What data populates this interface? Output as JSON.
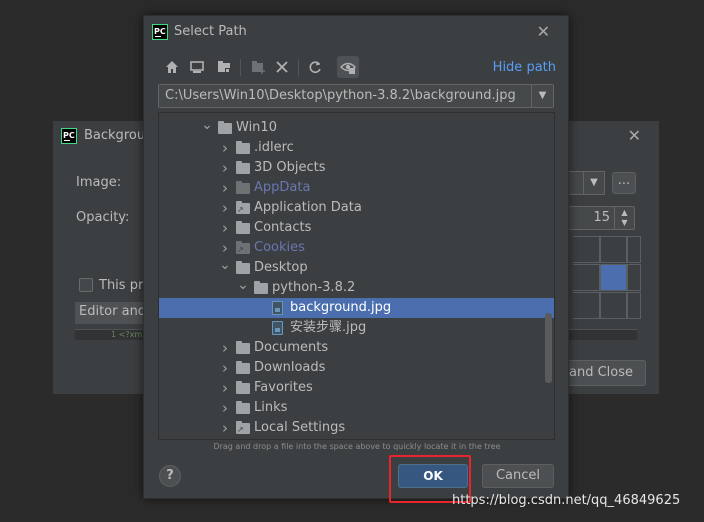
{
  "background_dialog": {
    "title": "Backgroun",
    "image_label": "Image:",
    "opacity_label": "Opacity:",
    "opacity_value": "15",
    "browse_label": "...",
    "checkbox_label": "This pro",
    "tab_label": "Editor and",
    "code_line": "1   <?xm",
    "save_button": "and Close"
  },
  "select_path_dialog": {
    "title": "Select Path",
    "hide_path_label": "Hide path",
    "path_value": "C:\\Users\\Win10\\Desktop\\python-3.8.2\\background.jpg",
    "toolbar": {
      "home_icon": "home-icon",
      "desktop_icon": "desktop-icon",
      "project_icon": "project-folder-icon",
      "new_folder_icon": "new-folder-icon",
      "delete_icon": "delete-icon",
      "refresh_icon": "refresh-icon",
      "show_hidden_icon": "show-hidden-icon"
    },
    "tree": [
      {
        "label": "Win10",
        "depth": 0,
        "expanded": true,
        "type": "folder"
      },
      {
        "label": ".idlerc",
        "depth": 1,
        "expanded": false,
        "type": "folder"
      },
      {
        "label": "3D Objects",
        "depth": 1,
        "expanded": false,
        "type": "folder"
      },
      {
        "label": "AppData",
        "depth": 1,
        "expanded": false,
        "type": "folder",
        "dim": true
      },
      {
        "label": "Application Data",
        "depth": 1,
        "expanded": false,
        "type": "folder",
        "shortcut": true
      },
      {
        "label": "Contacts",
        "depth": 1,
        "expanded": false,
        "type": "folder"
      },
      {
        "label": "Cookies",
        "depth": 1,
        "expanded": false,
        "type": "folder",
        "dim": true,
        "shortcut": true
      },
      {
        "label": "Desktop",
        "depth": 1,
        "expanded": true,
        "type": "folder"
      },
      {
        "label": "python-3.8.2",
        "depth": 2,
        "expanded": true,
        "type": "folder"
      },
      {
        "label": "background.jpg",
        "depth": 3,
        "type": "file",
        "selected": true
      },
      {
        "label": "安装步骤.jpg",
        "depth": 3,
        "type": "file"
      },
      {
        "label": "Documents",
        "depth": 1,
        "expanded": false,
        "type": "folder"
      },
      {
        "label": "Downloads",
        "depth": 1,
        "expanded": false,
        "type": "folder"
      },
      {
        "label": "Favorites",
        "depth": 1,
        "expanded": false,
        "type": "folder"
      },
      {
        "label": "Links",
        "depth": 1,
        "expanded": false,
        "type": "folder"
      },
      {
        "label": "Local Settings",
        "depth": 1,
        "expanded": false,
        "type": "folder",
        "shortcut": true
      },
      {
        "label": "",
        "depth": 1,
        "expanded": false,
        "type": "folder"
      }
    ],
    "drag_hint": "Drag and drop a file into the space above to quickly locate it in the tree",
    "help_label": "?",
    "ok_label": "OK",
    "cancel_label": "Cancel"
  },
  "watermark": "https://blog.csdn.net/qq_46849625",
  "colors": {
    "accent": "#589df6",
    "selection": "#4b6eaf",
    "ok_button": "#365880",
    "highlight": "#e8252b"
  }
}
